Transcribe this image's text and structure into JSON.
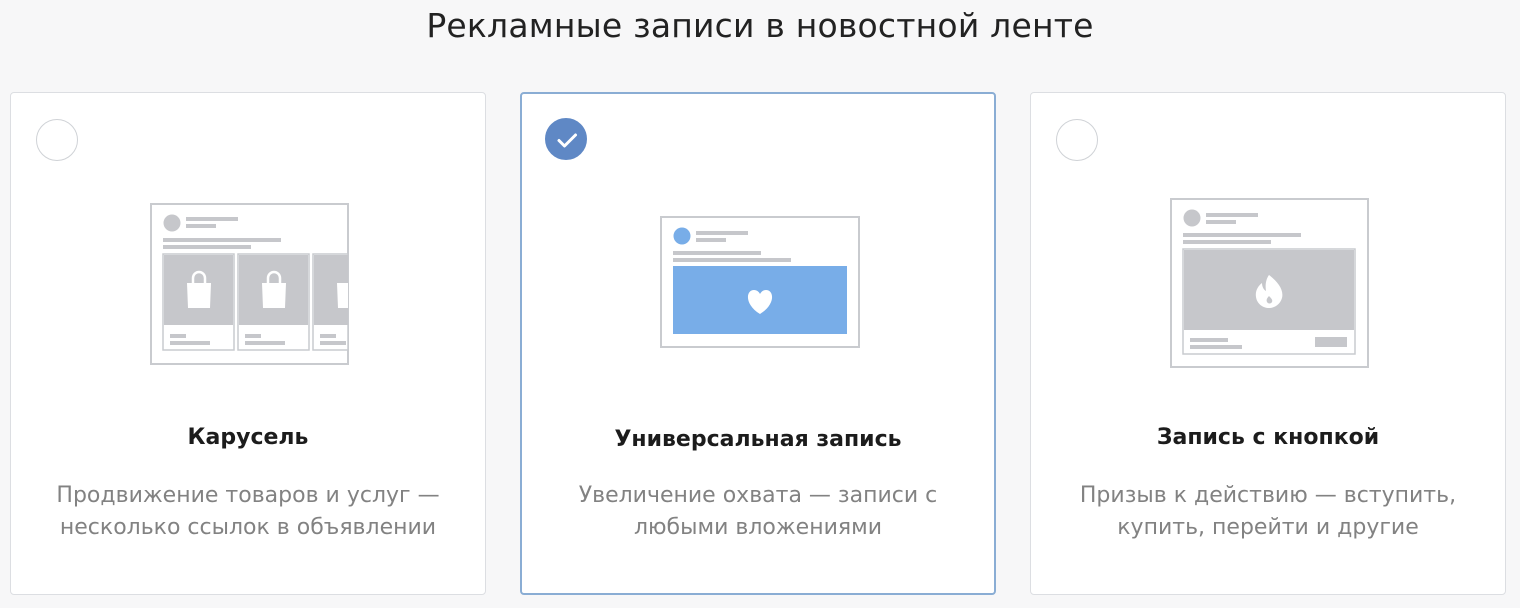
{
  "header": {
    "title": "Рекламные записи в новостной ленте"
  },
  "cards": [
    {
      "title": "Карусель",
      "description": "Продвижение товаров и услуг — несколько ссылок в объявлении",
      "selected": false,
      "preview_icon": "shopping-bag-icon"
    },
    {
      "title": "Универсальная запись",
      "description": "Увеличение охвата — записи с любыми вложениями",
      "selected": true,
      "preview_icon": "heart-icon"
    },
    {
      "title": "Запись с кнопкой",
      "description": "Призыв к действию — вступить, купить, перейти и другие",
      "selected": false,
      "preview_icon": "fire-icon"
    }
  ],
  "colors": {
    "accent": "#5f88c5",
    "selected_border": "#8aadd4",
    "preview_blue": "#78ade8",
    "preview_gray": "#c6c7cb"
  }
}
